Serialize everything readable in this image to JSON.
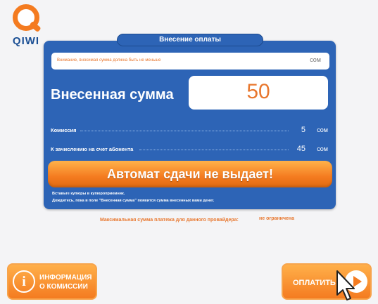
{
  "logo": {
    "text": "QIWI"
  },
  "header": {
    "tab_title": "Внесение оплаты"
  },
  "warning": {
    "text": "Внимание, вносимая сумма должна быть не меньше",
    "currency": "сом"
  },
  "amount": {
    "label": "Внесенная сумма",
    "value": "50"
  },
  "rows": [
    {
      "label": "Комиссия",
      "value": "5",
      "currency": "сом"
    },
    {
      "label": "К зачислению на счет абонента",
      "value": "45",
      "currency": "сом"
    }
  ],
  "banner": {
    "text": "Автомат сдачи не выдает!"
  },
  "notes": [
    "Вставьте купюры в купюроприемник.",
    "Дождитесь, пока в поле \"Внесенная сумма\" появится сумма внесенных вами денег."
  ],
  "max_payment": {
    "label": "Максимальная сумма платежа для данного провайдера:",
    "value": "не ограничена"
  },
  "buttons": {
    "info_line1": "ИНФОРМАЦИЯ",
    "info_line2": "О КОМИССИИ",
    "pay": "ОПЛАТИТЬ"
  },
  "colors": {
    "brand_blue": "#2d64b6",
    "accent_orange": "#f47b20"
  }
}
